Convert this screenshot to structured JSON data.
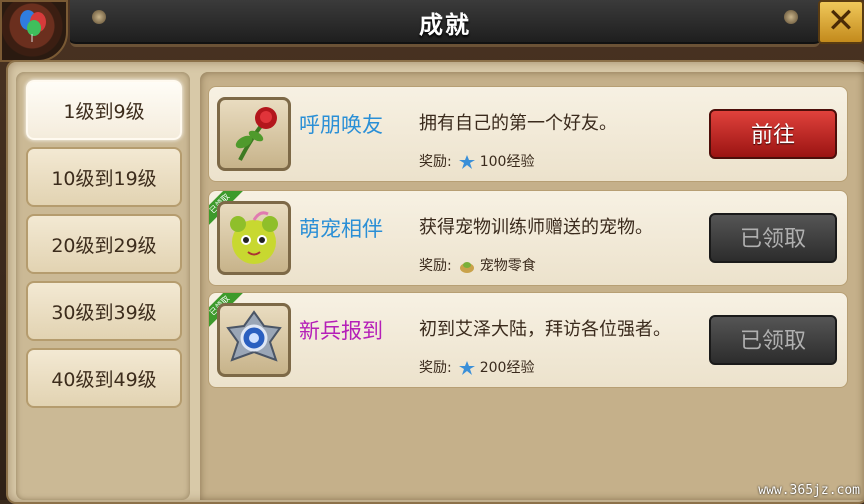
{
  "window": {
    "title": "成就",
    "close_label": "✕"
  },
  "sidebar": {
    "items": [
      {
        "label": "1级到9级",
        "active": true
      },
      {
        "label": "10级到19级",
        "active": false
      },
      {
        "label": "20级到29级",
        "active": false
      },
      {
        "label": "30级到39级",
        "active": false
      },
      {
        "label": "40级到49级",
        "active": false
      }
    ]
  },
  "achievements": [
    {
      "name": "呼朋唤友",
      "name_color": "#2a8fd6",
      "description": "拥有自己的第一个好友。",
      "reward_label": "奖励:",
      "reward_icon": "experience-icon",
      "reward_text": "100经验",
      "button_label": "前往",
      "state": "go",
      "ribbon": "",
      "icon": "rose-icon"
    },
    {
      "name": "萌宠相伴",
      "name_color": "#2a8fd6",
      "description": "获得宠物训练师赠送的宠物。",
      "reward_label": "奖励:",
      "reward_icon": "pet-snack-icon",
      "reward_text": "宠物零食",
      "button_label": "已领取",
      "state": "claimed",
      "ribbon": "已领取",
      "icon": "pet-icon"
    },
    {
      "name": "新兵报到",
      "name_color": "#b51fb8",
      "description": "初到艾泽大陆，拜访各位强者。",
      "reward_label": "奖励:",
      "reward_icon": "experience-icon",
      "reward_text": "200经验",
      "button_label": "已领取",
      "state": "claimed",
      "ribbon": "已领取",
      "icon": "badge-icon"
    }
  ],
  "watermark": "www.365jz.com"
}
